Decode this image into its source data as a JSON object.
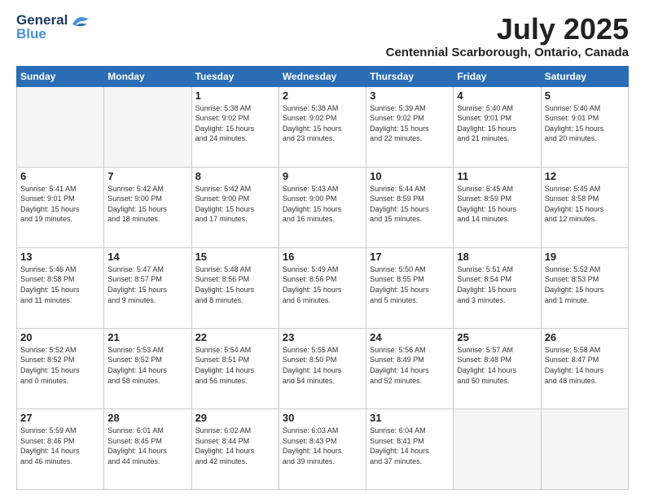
{
  "header": {
    "logo_general": "General",
    "logo_blue": "Blue",
    "month": "July 2025",
    "location": "Centennial Scarborough, Ontario, Canada"
  },
  "days_of_week": [
    "Sunday",
    "Monday",
    "Tuesday",
    "Wednesday",
    "Thursday",
    "Friday",
    "Saturday"
  ],
  "weeks": [
    [
      {
        "day": "",
        "info": ""
      },
      {
        "day": "",
        "info": ""
      },
      {
        "day": "1",
        "info": "Sunrise: 5:38 AM\nSunset: 9:02 PM\nDaylight: 15 hours\nand 24 minutes."
      },
      {
        "day": "2",
        "info": "Sunrise: 5:38 AM\nSunset: 9:02 PM\nDaylight: 15 hours\nand 23 minutes."
      },
      {
        "day": "3",
        "info": "Sunrise: 5:39 AM\nSunset: 9:02 PM\nDaylight: 15 hours\nand 22 minutes."
      },
      {
        "day": "4",
        "info": "Sunrise: 5:40 AM\nSunset: 9:01 PM\nDaylight: 15 hours\nand 21 minutes."
      },
      {
        "day": "5",
        "info": "Sunrise: 5:40 AM\nSunset: 9:01 PM\nDaylight: 15 hours\nand 20 minutes."
      }
    ],
    [
      {
        "day": "6",
        "info": "Sunrise: 5:41 AM\nSunset: 9:01 PM\nDaylight: 15 hours\nand 19 minutes."
      },
      {
        "day": "7",
        "info": "Sunrise: 5:42 AM\nSunset: 9:00 PM\nDaylight: 15 hours\nand 18 minutes."
      },
      {
        "day": "8",
        "info": "Sunrise: 5:42 AM\nSunset: 9:00 PM\nDaylight: 15 hours\nand 17 minutes."
      },
      {
        "day": "9",
        "info": "Sunrise: 5:43 AM\nSunset: 9:00 PM\nDaylight: 15 hours\nand 16 minutes."
      },
      {
        "day": "10",
        "info": "Sunrise: 5:44 AM\nSunset: 8:59 PM\nDaylight: 15 hours\nand 15 minutes."
      },
      {
        "day": "11",
        "info": "Sunrise: 5:45 AM\nSunset: 8:59 PM\nDaylight: 15 hours\nand 14 minutes."
      },
      {
        "day": "12",
        "info": "Sunrise: 5:45 AM\nSunset: 8:58 PM\nDaylight: 15 hours\nand 12 minutes."
      }
    ],
    [
      {
        "day": "13",
        "info": "Sunrise: 5:46 AM\nSunset: 8:58 PM\nDaylight: 15 hours\nand 11 minutes."
      },
      {
        "day": "14",
        "info": "Sunrise: 5:47 AM\nSunset: 8:57 PM\nDaylight: 15 hours\nand 9 minutes."
      },
      {
        "day": "15",
        "info": "Sunrise: 5:48 AM\nSunset: 8:56 PM\nDaylight: 15 hours\nand 8 minutes."
      },
      {
        "day": "16",
        "info": "Sunrise: 5:49 AM\nSunset: 8:56 PM\nDaylight: 15 hours\nand 6 minutes."
      },
      {
        "day": "17",
        "info": "Sunrise: 5:50 AM\nSunset: 8:55 PM\nDaylight: 15 hours\nand 5 minutes."
      },
      {
        "day": "18",
        "info": "Sunrise: 5:51 AM\nSunset: 8:54 PM\nDaylight: 15 hours\nand 3 minutes."
      },
      {
        "day": "19",
        "info": "Sunrise: 5:52 AM\nSunset: 8:53 PM\nDaylight: 15 hours\nand 1 minute."
      }
    ],
    [
      {
        "day": "20",
        "info": "Sunrise: 5:52 AM\nSunset: 8:52 PM\nDaylight: 15 hours\nand 0 minutes."
      },
      {
        "day": "21",
        "info": "Sunrise: 5:53 AM\nSunset: 8:52 PM\nDaylight: 14 hours\nand 58 minutes."
      },
      {
        "day": "22",
        "info": "Sunrise: 5:54 AM\nSunset: 8:51 PM\nDaylight: 14 hours\nand 56 minutes."
      },
      {
        "day": "23",
        "info": "Sunrise: 5:55 AM\nSunset: 8:50 PM\nDaylight: 14 hours\nand 54 minutes."
      },
      {
        "day": "24",
        "info": "Sunrise: 5:56 AM\nSunset: 8:49 PM\nDaylight: 14 hours\nand 52 minutes."
      },
      {
        "day": "25",
        "info": "Sunrise: 5:57 AM\nSunset: 8:48 PM\nDaylight: 14 hours\nand 50 minutes."
      },
      {
        "day": "26",
        "info": "Sunrise: 5:58 AM\nSunset: 8:47 PM\nDaylight: 14 hours\nand 48 minutes."
      }
    ],
    [
      {
        "day": "27",
        "info": "Sunrise: 5:59 AM\nSunset: 8:46 PM\nDaylight: 14 hours\nand 46 minutes."
      },
      {
        "day": "28",
        "info": "Sunrise: 6:01 AM\nSunset: 8:45 PM\nDaylight: 14 hours\nand 44 minutes."
      },
      {
        "day": "29",
        "info": "Sunrise: 6:02 AM\nSunset: 8:44 PM\nDaylight: 14 hours\nand 42 minutes."
      },
      {
        "day": "30",
        "info": "Sunrise: 6:03 AM\nSunset: 8:43 PM\nDaylight: 14 hours\nand 39 minutes."
      },
      {
        "day": "31",
        "info": "Sunrise: 6:04 AM\nSunset: 8:41 PM\nDaylight: 14 hours\nand 37 minutes."
      },
      {
        "day": "",
        "info": ""
      },
      {
        "day": "",
        "info": ""
      }
    ]
  ]
}
